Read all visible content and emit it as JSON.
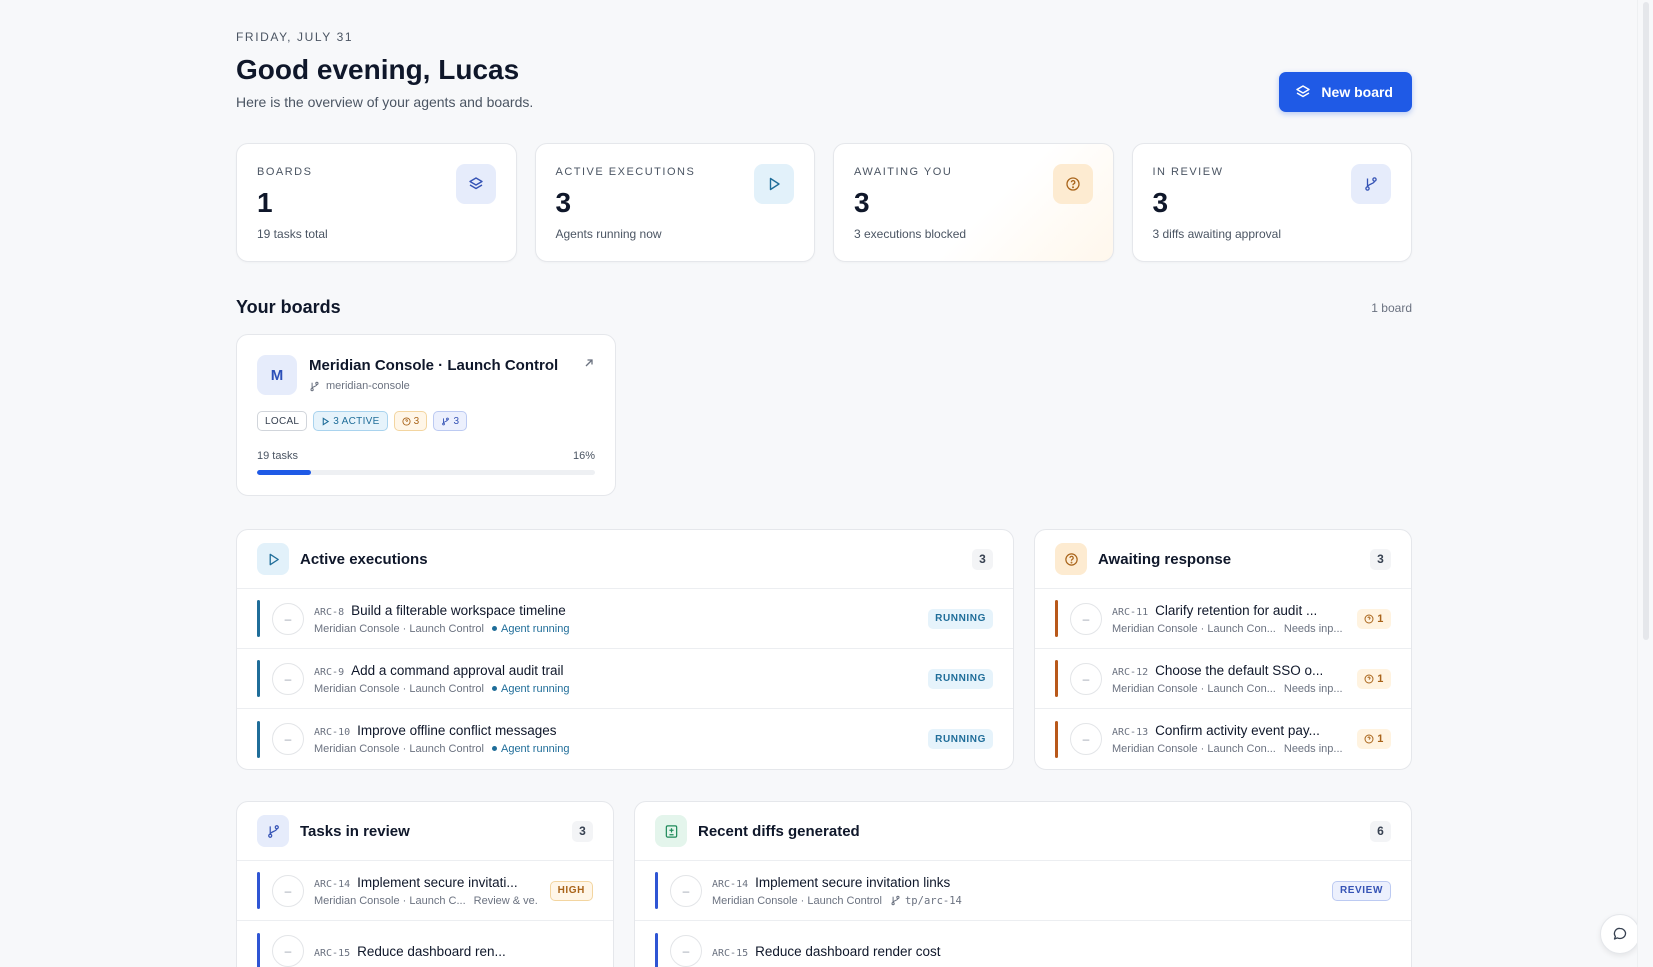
{
  "header": {
    "date": "FRIDAY, JULY 31",
    "greeting": "Good evening, Lucas",
    "subtitle": "Here is the overview of your agents and boards.",
    "new_board_label": "New board"
  },
  "stats": [
    {
      "label": "BOARDS",
      "value": "1",
      "note": "19 tasks total",
      "icon": "layers-icon"
    },
    {
      "label": "ACTIVE EXECUTIONS",
      "value": "3",
      "note": "Agents running now",
      "icon": "play-icon"
    },
    {
      "label": "AWAITING YOU",
      "value": "3",
      "note": "3 executions blocked",
      "icon": "question-icon"
    },
    {
      "label": "IN REVIEW",
      "value": "3",
      "note": "3 diffs awaiting approval",
      "icon": "branch-icon"
    }
  ],
  "boards_section": {
    "title": "Your boards",
    "meta": "1 board"
  },
  "board": {
    "avatar": "M",
    "name": "Meridian Console · Launch Control",
    "repo": "meridian-console",
    "chips": {
      "local": "LOCAL",
      "active": "3 ACTIVE",
      "awaiting": "3",
      "review": "3"
    },
    "tasks": "19 tasks",
    "progress_label": "16%",
    "progress": 0.16
  },
  "active_executions": {
    "title": "Active executions",
    "count": "3",
    "rows": [
      {
        "id": "ARC-8",
        "title": "Build a filterable workspace timeline",
        "board": "Meridian Console · Launch Control",
        "status": "Agent running",
        "badge": "RUNNING"
      },
      {
        "id": "ARC-9",
        "title": "Add a command approval audit trail",
        "board": "Meridian Console · Launch Control",
        "status": "Agent running",
        "badge": "RUNNING"
      },
      {
        "id": "ARC-10",
        "title": "Improve offline conflict messages",
        "board": "Meridian Console · Launch Control",
        "status": "Agent running",
        "badge": "RUNNING"
      }
    ]
  },
  "awaiting_response": {
    "title": "Awaiting response",
    "count": "3",
    "rows": [
      {
        "id": "ARC-11",
        "title": "Clarify retention for audit ...",
        "board": "Meridian Console · Launch Con...",
        "status": "Needs inp...",
        "badge": "1"
      },
      {
        "id": "ARC-12",
        "title": "Choose the default SSO o...",
        "board": "Meridian Console · Launch Con...",
        "status": "Needs inp...",
        "badge": "1"
      },
      {
        "id": "ARC-13",
        "title": "Confirm activity event pay...",
        "board": "Meridian Console · Launch Con...",
        "status": "Needs inp...",
        "badge": "1"
      }
    ]
  },
  "tasks_in_review": {
    "title": "Tasks in review",
    "count": "3",
    "rows": [
      {
        "id": "ARC-14",
        "title": "Implement secure invitati...",
        "board": "Meridian Console · Launch C...",
        "status": "Review & ve...",
        "badge": "HIGH"
      },
      {
        "id": "ARC-15",
        "title": "Reduce dashboard ren...",
        "board": "",
        "status": "",
        "badge": ""
      }
    ]
  },
  "recent_diffs": {
    "title": "Recent diffs generated",
    "count": "6",
    "rows": [
      {
        "id": "ARC-14",
        "title": "Implement secure invitation links",
        "board": "Meridian Console · Launch Control",
        "branch": "tp/arc-14",
        "badge": "REVIEW"
      },
      {
        "id": "ARC-15",
        "title": "Reduce dashboard render cost",
        "board": "",
        "branch": "",
        "badge": ""
      }
    ]
  },
  "colors": {
    "accent": "#1f5ae6",
    "running": "#1f6d99",
    "awaiting": "#b8581a",
    "review": "#2f55d4",
    "diff": "#1e8a5a"
  }
}
